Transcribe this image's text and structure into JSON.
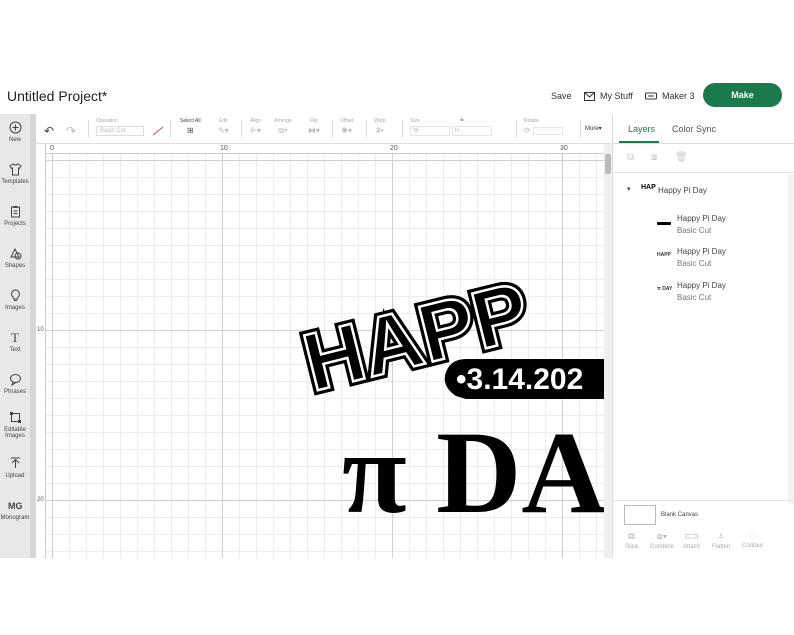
{
  "header": {
    "title": "Untitled Project*",
    "save_label": "Save",
    "my_stuff_label": "My Stuff",
    "machine_label": "Maker 3",
    "make_label": "Make"
  },
  "sidebar": {
    "items": [
      {
        "label": "New",
        "icon": "plus-circle-icon"
      },
      {
        "label": "Templates",
        "icon": "shirt-icon"
      },
      {
        "label": "Projects",
        "icon": "clipboard-icon"
      },
      {
        "label": "Shapes",
        "icon": "shapes-icon"
      },
      {
        "label": "Images",
        "icon": "bulb-icon"
      },
      {
        "label": "Text",
        "icon": "text-icon"
      },
      {
        "label": "Phrases",
        "icon": "speech-bubble-icon"
      },
      {
        "label": "Editable Images",
        "icon": "editable-image-icon"
      },
      {
        "label": "Upload",
        "icon": "upload-icon"
      },
      {
        "label": "Monogram",
        "icon": "monogram-icon"
      }
    ]
  },
  "toolbar": {
    "operation_label": "Operation",
    "operation_value": "Basic Cut",
    "select_all_label": "Select All",
    "edit_label": "Edit",
    "align_label": "Align",
    "arrange_label": "Arrange",
    "flip_label": "Flip",
    "offset_label": "Offset",
    "warp_label": "Warp",
    "size_label": "Size",
    "size_w": "W",
    "size_h": "H",
    "rotate_label": "Rotate",
    "more_label": "More▾"
  },
  "rulers": {
    "top": [
      "0",
      "10",
      "20",
      "30"
    ],
    "left": [
      "10",
      "20"
    ]
  },
  "canvas": {
    "text_happy": "HAPP",
    "text_date": "•3.14.202",
    "text_pi_day": "π DA"
  },
  "panel": {
    "tab_layers": "Layers",
    "tab_color_sync": "Color Sync",
    "group_name": "Happy Pi Day",
    "layers": [
      {
        "name": "Happy Pi Day",
        "op": "Basic Cut"
      },
      {
        "name": "Happy Pi Day",
        "op": "Basic Cut"
      },
      {
        "name": "Happy Pi Day",
        "op": "Basic Cut"
      }
    ],
    "blank_canvas_label": "Blank Canvas",
    "tools": [
      "Slice",
      "Combine",
      "Attach",
      "Flatten",
      "Contour"
    ]
  },
  "colors": {
    "accent": "#1b7a4b",
    "sidebar_bg": "#e8e8e8"
  }
}
